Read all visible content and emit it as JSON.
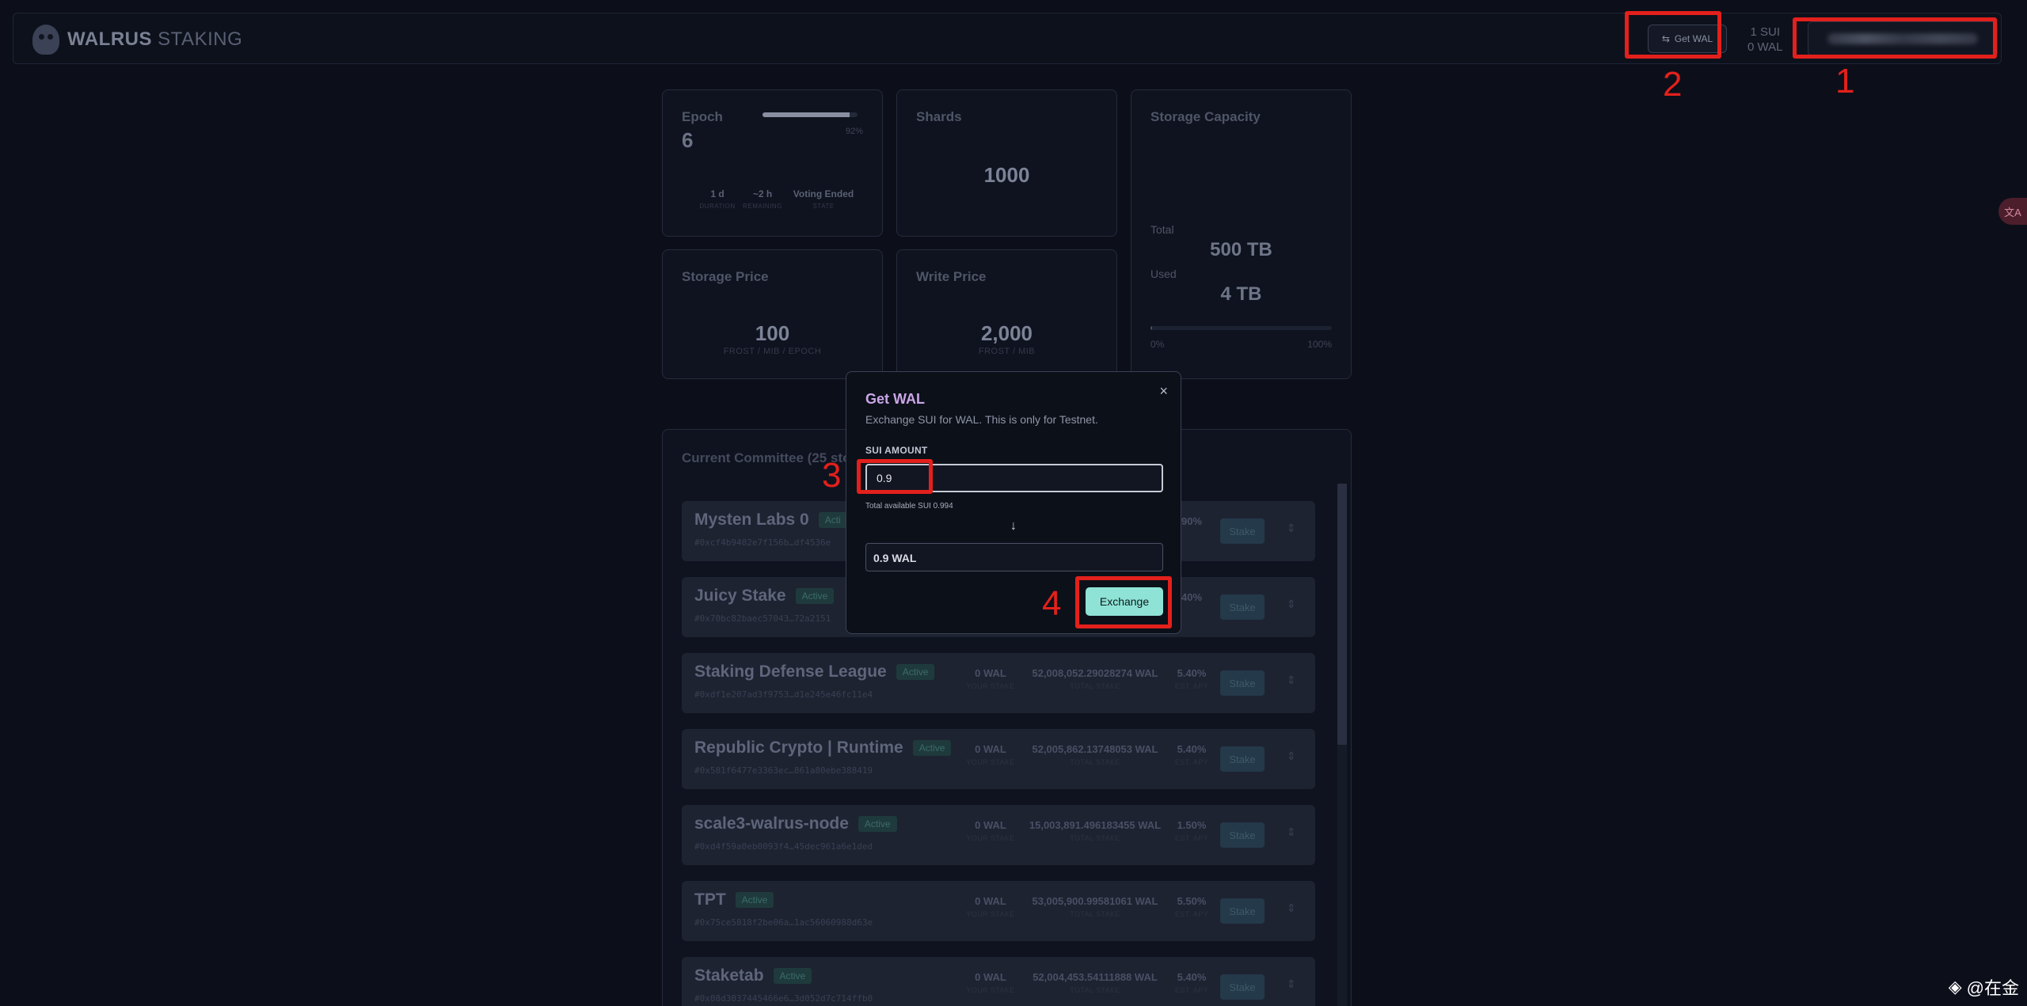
{
  "header": {
    "logo_bold": "WALRUS",
    "logo_light": "STAKING",
    "get_wal_label": "Get WAL",
    "sui_balance": "1 SUI",
    "wal_balance": "0 WAL"
  },
  "annotations": [
    "1",
    "2",
    "3",
    "4"
  ],
  "stats": {
    "epoch": {
      "title": "Epoch",
      "value": "6",
      "progress_percent": 92,
      "progress_label": "92%",
      "duration_value": "1 d",
      "duration_label": "DURATION",
      "remaining_value": "~2 h",
      "remaining_label": "REMAINING",
      "state_value": "Voting Ended",
      "state_label": "STATE"
    },
    "shards": {
      "title": "Shards",
      "value": "1000"
    },
    "storage_capacity": {
      "title": "Storage Capacity",
      "total_label": "Total",
      "total_value": "500 TB",
      "used_label": "Used",
      "used_value": "4 TB",
      "min_label": "0%",
      "max_label": "100%",
      "used_fraction": 0.008
    },
    "storage_price": {
      "title": "Storage Price",
      "value": "100",
      "unit": "FROST / MIB / EPOCH"
    },
    "write_price": {
      "title": "Write Price",
      "value": "2,000",
      "unit": "FROST / MIB"
    }
  },
  "committee": {
    "title": "Current Committee (25 stor",
    "stake_label": "Stake",
    "nodes": [
      {
        "name": "Mysten Labs 0",
        "badge": "Acti",
        "address": "#0xcf4b9402e7f156b…df4536e",
        "wal": "",
        "wal_label": "",
        "total": "",
        "total_label": "",
        "apy": "90%",
        "apy_label": ""
      },
      {
        "name": "Juicy Stake",
        "badge": "Active",
        "address": "#0x70bc82baec57043…72a2151",
        "wal": "",
        "wal_label": "",
        "total": "",
        "total_label": "",
        "apy": "40%",
        "apy_label": ""
      },
      {
        "name": "Staking Defense League",
        "badge": "Active",
        "address": "#0xdf1e207ad3f9753…d1e245e46fc11e4",
        "wal": "0 WAL",
        "wal_label": "YOUR STAKE",
        "total": "52,008,052.29028274 WAL",
        "total_label": "TOTAL STAKE",
        "apy": "5.40%",
        "apy_label": "EST. APY"
      },
      {
        "name": "Republic Crypto | Runtime",
        "badge": "Active",
        "address": "#0x581f6477e3363ec…861a80ebe388419",
        "wal": "0 WAL",
        "wal_label": "YOUR STAKE",
        "total": "52,005,862.13748053 WAL",
        "total_label": "TOTAL STAKE",
        "apy": "5.40%",
        "apy_label": "EST. APY"
      },
      {
        "name": "scale3-walrus-node",
        "badge": "Active",
        "address": "#0xd4f59a0eb0093f4…45dec961a6e1ded",
        "wal": "0 WAL",
        "wal_label": "YOUR STAKE",
        "total": "15,003,891.496183455 WAL",
        "total_label": "TOTAL STAKE",
        "apy": "1.50%",
        "apy_label": "EST. APY"
      },
      {
        "name": "TPT",
        "badge": "Active",
        "address": "#0x75ce5818f2be06a…1ac56060988d63e",
        "wal": "0 WAL",
        "wal_label": "YOUR STAKE",
        "total": "53,005,900.99581061 WAL",
        "total_label": "TOTAL STAKE",
        "apy": "5.50%",
        "apy_label": "EST. APY"
      },
      {
        "name": "Staketab",
        "badge": "Active",
        "address": "#0x08d3037445466e6…3d052d7c714ffb0",
        "wal": "0 WAL",
        "wal_label": "YOUR STAKE",
        "total": "52,004,453.54111888 WAL",
        "total_label": "TOTAL STAKE",
        "apy": "5.40%",
        "apy_label": "EST. APY"
      }
    ]
  },
  "modal": {
    "title": "Get WAL",
    "description": "Exchange SUI for WAL. This is only for Testnet.",
    "amount_label": "SUI AMOUNT",
    "amount_value": "0.9",
    "available": "Total available SUI 0.994",
    "output_value": "0.9 WAL",
    "exchange_label": "Exchange",
    "close_glyph": "×",
    "arrow_glyph": "↓"
  },
  "side_tab": "文A",
  "watermark": "@在金",
  "colors": {
    "accent": "#8ee3d6",
    "title_purple": "#cba6e8",
    "annotation_red": "#e3201b"
  }
}
